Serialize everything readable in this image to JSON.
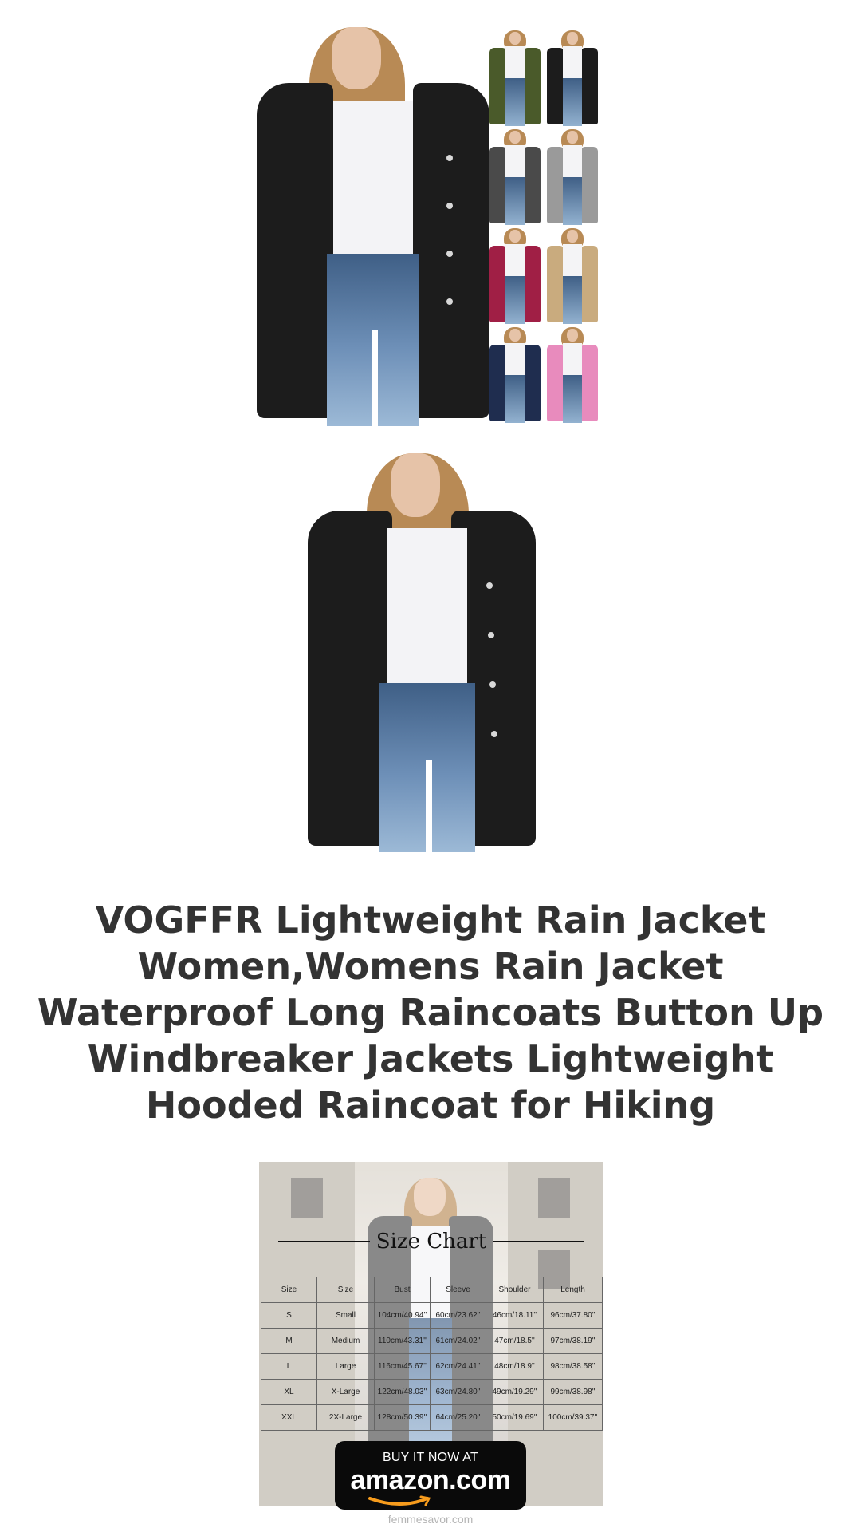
{
  "product": {
    "title": "VOGFFR Lightweight Rain Jacket Women,Womens Rain Jacket Waterproof Long Raincoats Button Up Windbreaker Jackets Lightweight Hooded Raincoat for Hiking",
    "color_options": [
      "#4a5a2a",
      "#1c1c1c",
      "#4a4a4a",
      "#9a9a9a",
      "#a01f45",
      "#c9ab7e",
      "#1f2d4f",
      "#e88bbd"
    ]
  },
  "size_chart": {
    "title": "Size Chart",
    "headers": [
      "Size",
      "Size",
      "Bust",
      "Sleeve",
      "Shoulder",
      "Length"
    ],
    "rows": [
      [
        "S",
        "Small",
        "104cm/40.94''",
        "60cm/23.62''",
        "46cm/18.11''",
        "96cm/37.80''"
      ],
      [
        "M",
        "Medium",
        "110cm/43.31''",
        "61cm/24.02''",
        "47cm/18.5''",
        "97cm/38.19''"
      ],
      [
        "L",
        "Large",
        "116cm/45.67''",
        "62cm/24.41''",
        "48cm/18.9''",
        "98cm/38.58''"
      ],
      [
        "XL",
        "X-Large",
        "122cm/48.03''",
        "63cm/24.80''",
        "49cm/19.29''",
        "99cm/38.98''"
      ],
      [
        "XXL",
        "2X-Large",
        "128cm/50.39''",
        "64cm/25.20''",
        "50cm/19.69''",
        "100cm/39.37''"
      ]
    ]
  },
  "buy_button": {
    "caption": "BUY IT NOW AT",
    "brand": "amazon.com"
  },
  "footer": {
    "site": "femmesavor.com"
  }
}
